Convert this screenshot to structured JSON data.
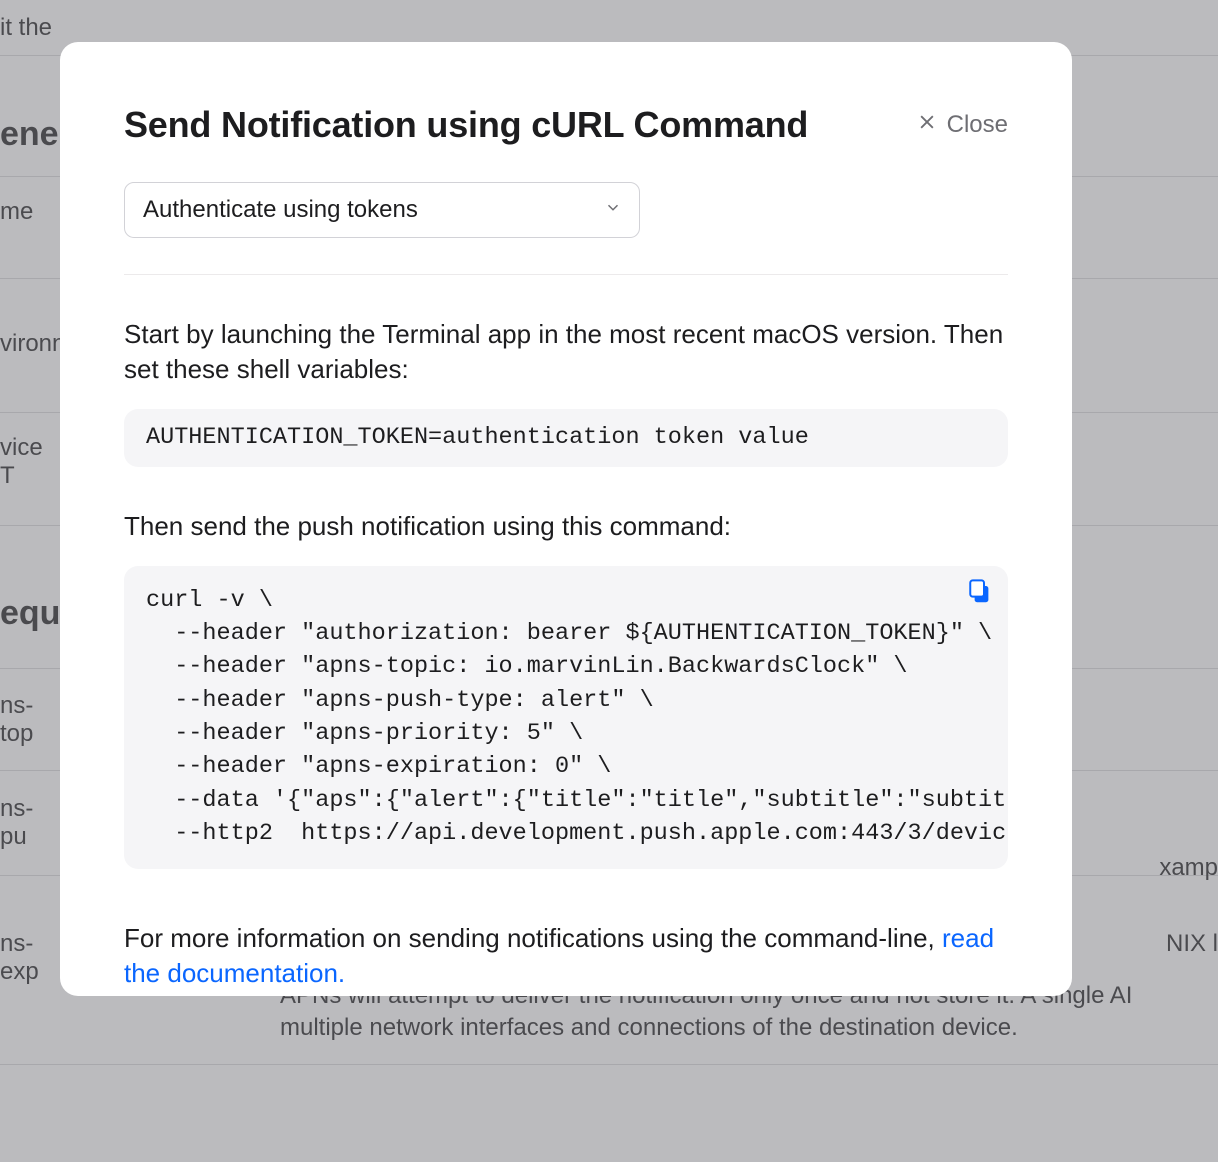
{
  "background": {
    "row_edit": "it the",
    "section_general": "ene",
    "row_name": "me",
    "row_environment": "vironn",
    "row_device_token": "vice T",
    "section_request": "equ",
    "row_apns_topic": "ns-top",
    "row_apns_push": "ns-pu",
    "row_apns_exp": "ns-exp",
    "right_1": "xamp",
    "right_2": "NIX l",
    "bottom_line1": "APNs will attempt to deliver the notification only once and not store it. A single AI",
    "bottom_line2": "multiple network interfaces and connections of the destination device."
  },
  "modal": {
    "title": "Send Notification using cURL Command",
    "close_label": "Close",
    "select_value": "Authenticate using tokens",
    "intro": "Start by launching the Terminal app in the most recent macOS version. Then set these shell variables:",
    "code1": "AUTHENTICATION_TOKEN=authentication token value",
    "then_text": "Then send the push notification using this command:",
    "code2": "curl -v \\\n  --header \"authorization: bearer ${AUTHENTICATION_TOKEN}\" \\\n  --header \"apns-topic: io.marvinLin.BackwardsClock\" \\\n  --header \"apns-push-type: alert\" \\\n  --header \"apns-priority: 5\" \\\n  --header \"apns-expiration: 0\" \\\n  --data '{\"aps\":{\"alert\":{\"title\":\"title\",\"subtitle\":\"subtit\n  --http2  https://api.development.push.apple.com:443/3/devic",
    "footer_text": "For more information on sending notifications using the command-line, ",
    "footer_link": "read the documentation."
  }
}
